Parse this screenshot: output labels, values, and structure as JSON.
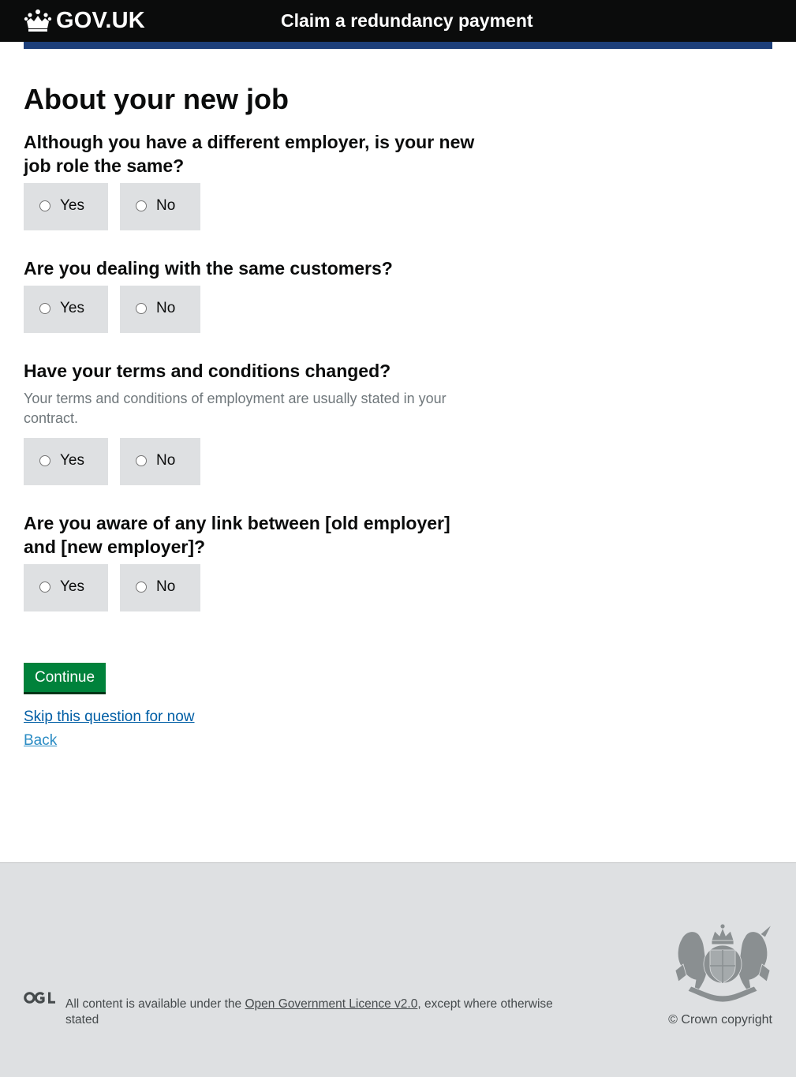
{
  "header": {
    "logo_text": "GOV.UK",
    "logo_icon": "crown-icon",
    "service_name": "Claim a redundancy payment"
  },
  "main": {
    "title": "About your new job",
    "questions": [
      {
        "legend": "Although you have a different employer, is your new job role the same?",
        "hint": "",
        "options": [
          "Yes",
          "No"
        ]
      },
      {
        "legend": "Are you dealing with the same customers?",
        "hint": "",
        "options": [
          "Yes",
          "No"
        ]
      },
      {
        "legend": "Have your terms and conditions changed?",
        "hint": "Your terms and conditions of employment are usually stated in your contract.",
        "options": [
          "Yes",
          "No"
        ]
      },
      {
        "legend": "Are you aware of any link between [old employer] and [new employer]?",
        "hint": "",
        "options": [
          "Yes",
          "No"
        ]
      }
    ],
    "continue_label": "Continue",
    "skip_label": "Skip this question for now",
    "back_label": "Back"
  },
  "footer": {
    "licence_prefix": "All content is available under the ",
    "licence_link": "Open Government Licence v2.0",
    "licence_suffix": ", except where otherwise stated",
    "copyright": "© Crown copyright",
    "ogl_icon": "ogl-logo-icon",
    "crest_icon": "royal-coat-of-arms-icon"
  },
  "colors": {
    "header_bg": "#0b0c0c",
    "blue_bar": "#1d3f7a",
    "button_green": "#00823b",
    "link_blue": "#005ea5",
    "visited_link": "#2b8cc4",
    "option_bg": "#dee0e2",
    "footer_bg": "#dee0e2",
    "hint_text": "#6f777b"
  }
}
